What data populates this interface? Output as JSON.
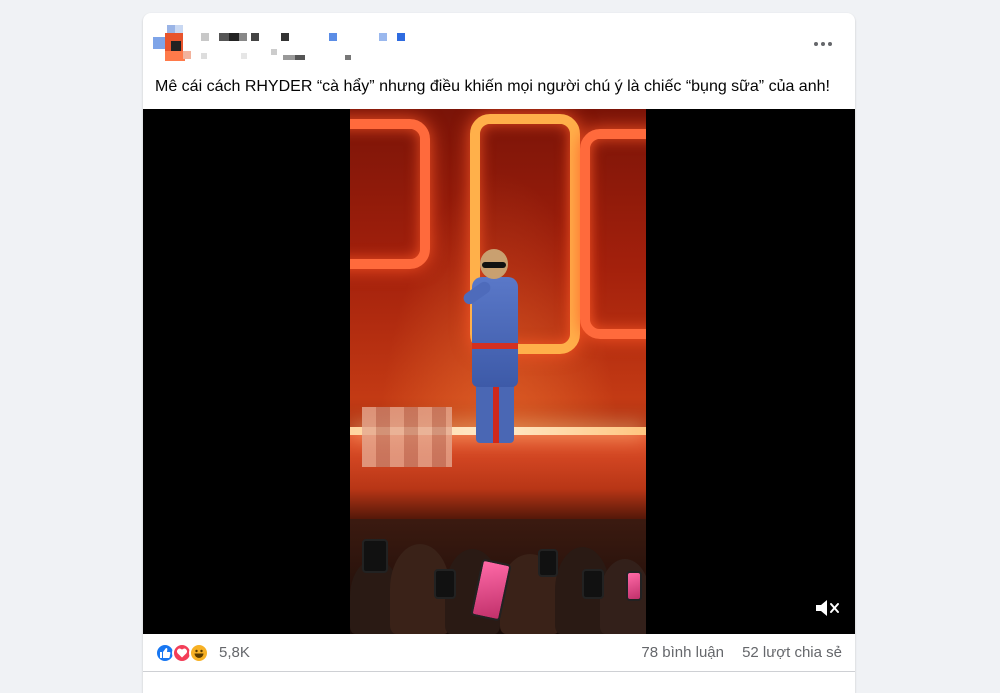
{
  "post": {
    "author_name": "",
    "caption": "Mê cái cách RHYDER “cà hẩy” nhưng điều khiến mọi người chú ý là chiếc “bụng sữa” của anh!",
    "more_icon": "more-horizontal-icon"
  },
  "video": {
    "mute_icon": "speaker-muted-icon"
  },
  "stats": {
    "reaction_icons": [
      "like-icon",
      "love-icon",
      "haha-icon"
    ],
    "reaction_count": "5,8K",
    "comments": "78 bình luận",
    "shares": "52 lượt chia sẻ"
  },
  "colors": {
    "background": "#f0f2f5",
    "card": "#ffffff",
    "like": "#1877f2",
    "love": "#f33e58",
    "haha": "#f7b125",
    "secondary_text": "#65676b"
  }
}
